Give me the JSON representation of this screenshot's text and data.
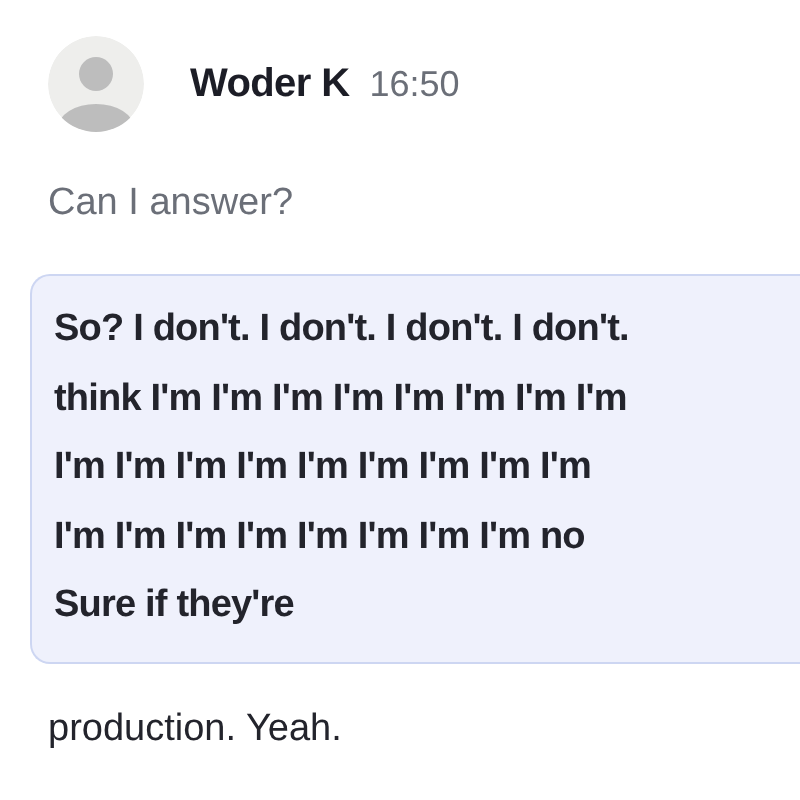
{
  "message": {
    "author": "Woder K",
    "time": "16:50",
    "question": "Can I answer?",
    "quote_lines": [
      "So? I don't. I don't. I don't. I don't.",
      "think I'm I'm I'm I'm I'm I'm I'm I'm",
      "I'm I'm I'm I'm I'm I'm I'm I'm I'm",
      "I'm I'm I'm I'm I'm I'm I'm I'm no",
      "Sure if they're"
    ],
    "after": "production. Yeah."
  }
}
